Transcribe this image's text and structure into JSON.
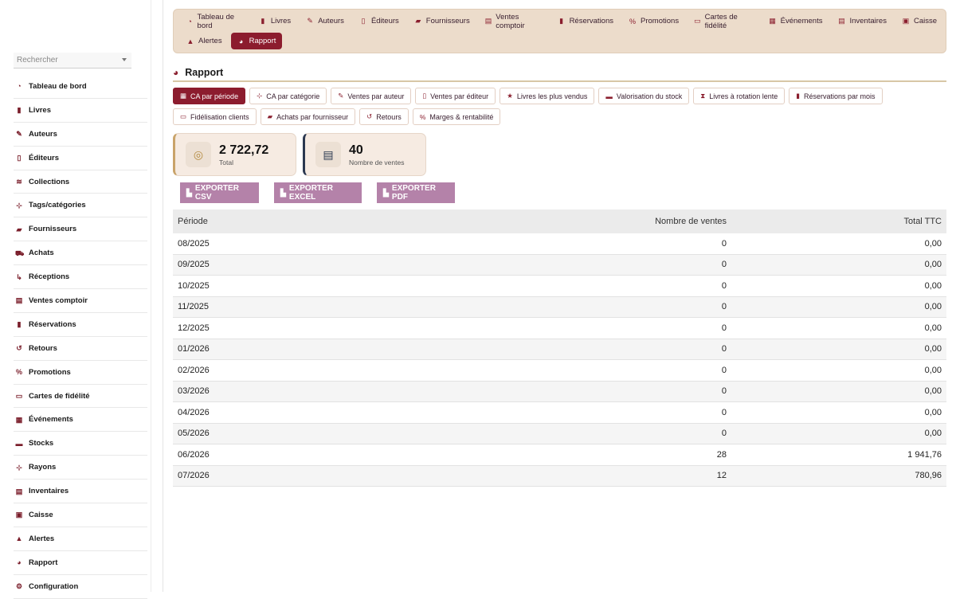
{
  "sidebar": {
    "search_placeholder": "Rechercher",
    "items": [
      {
        "label": "Tableau de bord",
        "icon": "gauge-icon",
        "glyph": "◔"
      },
      {
        "label": "Livres",
        "icon": "book-icon",
        "glyph": "▮"
      },
      {
        "label": "Auteurs",
        "icon": "feather-icon",
        "glyph": "✎"
      },
      {
        "label": "Éditeurs",
        "icon": "building-icon",
        "glyph": "▯"
      },
      {
        "label": "Collections",
        "icon": "layers-icon",
        "glyph": "≋"
      },
      {
        "label": "Tags/catégories",
        "icon": "sitemap-icon",
        "glyph": "⊹"
      },
      {
        "label": "Fournisseurs",
        "icon": "truck-icon",
        "glyph": "▰"
      },
      {
        "label": "Achats",
        "icon": "cart-icon",
        "glyph": "⛟"
      },
      {
        "label": "Réceptions",
        "icon": "dolly-icon",
        "glyph": "↳"
      },
      {
        "label": "Ventes comptoir",
        "icon": "cash-register-icon",
        "glyph": "▤"
      },
      {
        "label": "Réservations",
        "icon": "bookmark-icon",
        "glyph": "▮"
      },
      {
        "label": "Retours",
        "icon": "undo-icon",
        "glyph": "↺"
      },
      {
        "label": "Promotions",
        "icon": "percent-icon",
        "glyph": "%"
      },
      {
        "label": "Cartes de fidélité",
        "icon": "id-card-icon",
        "glyph": "▭"
      },
      {
        "label": "Événements",
        "icon": "calendar-icon",
        "glyph": "▦"
      },
      {
        "label": "Stocks",
        "icon": "warehouse-icon",
        "glyph": "▬"
      },
      {
        "label": "Rayons",
        "icon": "sitemap-icon",
        "glyph": "⊹"
      },
      {
        "label": "Inventaires",
        "icon": "clipboard-icon",
        "glyph": "▤"
      },
      {
        "label": "Caisse",
        "icon": "money-icon",
        "glyph": "▣"
      },
      {
        "label": "Alertes",
        "icon": "warning-icon",
        "glyph": "▲"
      },
      {
        "label": "Rapport",
        "icon": "chart-pie-icon",
        "glyph": "◕"
      },
      {
        "label": "Configuration",
        "icon": "gear-icon",
        "glyph": "⚙"
      }
    ]
  },
  "topnav": {
    "row1": [
      {
        "label": "Tableau de bord",
        "icon": "gauge-icon",
        "glyph": "◔"
      },
      {
        "label": "Livres",
        "icon": "book-icon",
        "glyph": "▮"
      },
      {
        "label": "Auteurs",
        "icon": "feather-icon",
        "glyph": "✎"
      },
      {
        "label": "Éditeurs",
        "icon": "building-icon",
        "glyph": "▯"
      },
      {
        "label": "Fournisseurs",
        "icon": "truck-icon",
        "glyph": "▰"
      },
      {
        "label": "Ventes comptoir",
        "icon": "cash-register-icon",
        "glyph": "▤"
      },
      {
        "label": "Réservations",
        "icon": "bookmark-icon",
        "glyph": "▮"
      },
      {
        "label": "Promotions",
        "icon": "percent-icon",
        "glyph": "%"
      },
      {
        "label": "Cartes de fidélité",
        "icon": "id-card-icon",
        "glyph": "▭"
      },
      {
        "label": "Événements",
        "icon": "calendar-icon",
        "glyph": "▦"
      },
      {
        "label": "Inventaires",
        "icon": "clipboard-icon",
        "glyph": "▤"
      },
      {
        "label": "Caisse",
        "icon": "money-icon",
        "glyph": "▣"
      }
    ],
    "row2": [
      {
        "label": "Alertes",
        "icon": "warning-icon",
        "glyph": "▲",
        "active": false
      },
      {
        "label": "Rapport",
        "icon": "chart-pie-icon",
        "glyph": "◕",
        "active": true
      }
    ]
  },
  "page": {
    "title": "Rapport",
    "title_icon": "chart-pie-icon"
  },
  "report_tabs": {
    "row1": [
      {
        "label": "CA par période",
        "icon": "calendar-icon",
        "glyph": "▦",
        "active": true
      },
      {
        "label": "CA par catégorie",
        "icon": "sitemap-icon",
        "glyph": "⊹",
        "active": false
      },
      {
        "label": "Ventes par auteur",
        "icon": "feather-icon",
        "glyph": "✎",
        "active": false
      },
      {
        "label": "Ventes par éditeur",
        "icon": "building-icon",
        "glyph": "▯",
        "active": false
      },
      {
        "label": "Livres les plus vendus",
        "icon": "star-icon",
        "glyph": "★",
        "active": false
      },
      {
        "label": "Valorisation du stock",
        "icon": "warehouse-icon",
        "glyph": "▬",
        "active": false
      },
      {
        "label": "Livres à rotation lente",
        "icon": "hourglass-icon",
        "glyph": "⧗",
        "active": false
      },
      {
        "label": "Réservations par mois",
        "icon": "bookmark-icon",
        "glyph": "▮",
        "active": false
      }
    ],
    "row2": [
      {
        "label": "Fidélisation clients",
        "icon": "id-card-icon",
        "glyph": "▭",
        "active": false
      },
      {
        "label": "Achats par fournisseur",
        "icon": "truck-icon",
        "glyph": "▰",
        "active": false
      },
      {
        "label": "Retours",
        "icon": "undo-icon",
        "glyph": "↺",
        "active": false
      },
      {
        "label": "Marges & rentabilité",
        "icon": "percent-icon",
        "glyph": "%",
        "active": false
      }
    ]
  },
  "stats": {
    "total": {
      "value": "2 722,72",
      "label": "Total",
      "icon": "coins-icon"
    },
    "sales": {
      "value": "40",
      "label": "Nombre de ventes",
      "icon": "receipt-icon"
    }
  },
  "exports": {
    "csv": "EXPORTER CSV",
    "excel": "EXPORTER EXCEL",
    "pdf": "EXPORTER PDF"
  },
  "table": {
    "headers": [
      "Période",
      "Nombre de ventes",
      "Total TTC"
    ],
    "rows": [
      [
        "08/2025",
        "0",
        "0,00"
      ],
      [
        "09/2025",
        "0",
        "0,00"
      ],
      [
        "10/2025",
        "0",
        "0,00"
      ],
      [
        "11/2025",
        "0",
        "0,00"
      ],
      [
        "12/2025",
        "0",
        "0,00"
      ],
      [
        "01/2026",
        "0",
        "0,00"
      ],
      [
        "02/2026",
        "0",
        "0,00"
      ],
      [
        "03/2026",
        "0",
        "0,00"
      ],
      [
        "04/2026",
        "0",
        "0,00"
      ],
      [
        "05/2026",
        "0",
        "0,00"
      ],
      [
        "06/2026",
        "28",
        "1 941,76"
      ],
      [
        "07/2026",
        "12",
        "780,96"
      ]
    ]
  },
  "colors": {
    "accent": "#8c1c2e",
    "nav_bg": "#ecdccb",
    "export_bg": "#b482a9"
  }
}
